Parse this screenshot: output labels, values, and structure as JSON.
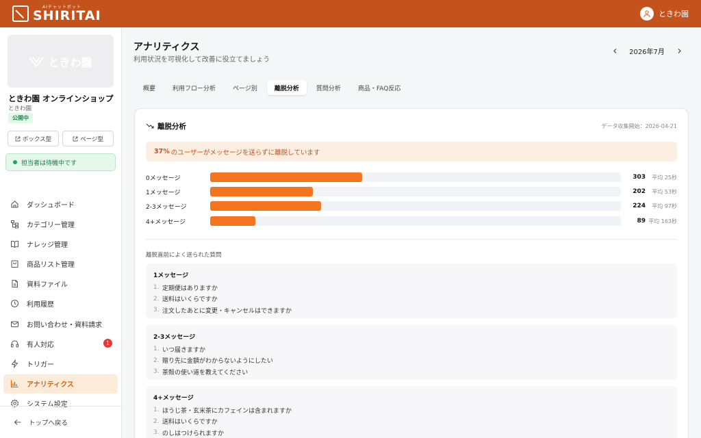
{
  "header": {
    "brand_sub": "AIチャットボット",
    "brand_name": "SHIRITAI",
    "user_name": "ときわ園"
  },
  "sidebar": {
    "thumb_text": "ときわ園",
    "shop_name": "ときわ園 オンラインショップ",
    "shop_sub": "ときわ園",
    "public_badge": "公開中",
    "box_type_label": "ボックス型",
    "page_type_label": "ページ型",
    "status_text": "担当者は待機中です",
    "items": [
      {
        "label": "ダッシュボード",
        "icon": "home-icon"
      },
      {
        "label": "カテゴリー管理",
        "icon": "tree-icon"
      },
      {
        "label": "ナレッジ管理",
        "icon": "book-icon"
      },
      {
        "label": "商品リスト管理",
        "icon": "bag-icon"
      },
      {
        "label": "資料ファイル",
        "icon": "file-icon"
      },
      {
        "label": "利用履歴",
        "icon": "clock-icon"
      },
      {
        "label": "お問い合わせ・資料請求",
        "icon": "mail-icon"
      },
      {
        "label": "有人対応",
        "icon": "headset-icon",
        "badge": "1"
      },
      {
        "label": "トリガー",
        "icon": "bolt-icon"
      },
      {
        "label": "アナリティクス",
        "icon": "chart-icon",
        "active": true
      },
      {
        "label": "システム設定",
        "icon": "gear-icon"
      }
    ],
    "back_label": "トップへ戻る"
  },
  "page": {
    "title": "アナリティクス",
    "subtitle": "利用状況を可視化して改善に役立てましょう",
    "month": "2026年7月"
  },
  "tabs": [
    {
      "label": "概要"
    },
    {
      "label": "利用フロー分析"
    },
    {
      "label": "ページ別"
    },
    {
      "label": "離脱分析",
      "active": true
    },
    {
      "label": "質問分析"
    },
    {
      "label": "商品・FAQ反応"
    }
  ],
  "card": {
    "title": "離脱分析",
    "meta": "データ収集開始：2026-04-21",
    "alert_pct": "37%",
    "alert_text": "のユーザーがメッセージを送らずに離脱しています",
    "bars": [
      {
        "label": "0メッセージ",
        "count": 303,
        "avg": "平均 25秒",
        "fill": 0.37
      },
      {
        "label": "1メッセージ",
        "count": 202,
        "avg": "平均 53秒",
        "fill": 0.25
      },
      {
        "label": "2-3メッセージ",
        "count": 224,
        "avg": "平均 97秒",
        "fill": 0.27
      },
      {
        "label": "4+メッセージ",
        "count": 89,
        "avg": "平均 163秒",
        "fill": 0.11
      }
    ],
    "questions_heading": "離脱直前によく送られた質問",
    "groups": [
      {
        "title": "1メッセージ",
        "items": [
          "定期便はありますか",
          "送料はいくらですか",
          "注文したあとに変更・キャンセルはできますか"
        ]
      },
      {
        "title": "2-3メッセージ",
        "items": [
          "いつ届きますか",
          "贈り先に金額がわからないようにしたい",
          "茶殻の使い道を教えてください"
        ]
      },
      {
        "title": "4+メッセージ",
        "items": [
          "ほうじ茶・玄米茶にカフェインは含まれますか",
          "送料はいくらですか",
          "のしはつけられますか"
        ]
      }
    ]
  },
  "colors": {
    "brand": "#c4521c",
    "bar": "#f5751f",
    "active_nav_bg": "#fdebd9"
  }
}
